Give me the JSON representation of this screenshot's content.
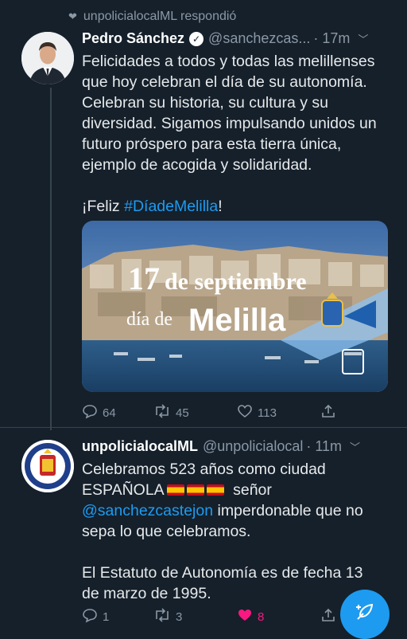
{
  "reply_header": {
    "text": "unpolicialocalML respondió",
    "icon": "heart-icon"
  },
  "tweet1": {
    "name": "Pedro Sánchez",
    "handle": "@sanchezcas...",
    "time": "· 17m",
    "body_lines": [
      "Felicidades a todos y todas las melillenses",
      "que hoy celebran el día de su autonomía.",
      "Celebran su historia, su cultura y su",
      "diversidad. Sigamos impulsando unidos un",
      "futuro próspero para esta tierra única,",
      "ejemplo de acogida y solidaridad."
    ],
    "closing_prefix": "¡Feliz ",
    "hashtag": "#DíadeMelilla",
    "closing_suffix": "!",
    "media": {
      "line1_num": "17",
      "line1_rest": "de septiembre",
      "line2_prefix": "día de",
      "line2_city": "Melilla"
    },
    "actions": {
      "replies": "64",
      "retweets": "45",
      "likes": "113"
    }
  },
  "tweet2": {
    "name": "unpolicialocalML",
    "handle": "@unpolicialocal",
    "time": "· 11m",
    "avatar_text": "POLICÍA LOCAL",
    "avatar_text_bottom": "MELILLA",
    "line1": "Celebramos 523 años como ciudad",
    "line2_text": "ESPAÑOLA",
    "line2_suffix": "señor",
    "mention": "@sanchezcastejon",
    "line3_suffix": " imperdonable que no",
    "line4": "sepa lo que celebramos.",
    "para2_line1": "El Estatuto de Autonomía es de fecha 13",
    "para2_line2": "de marzo de 1995.",
    "actions": {
      "replies": "1",
      "retweets": "3",
      "likes": "8"
    }
  },
  "colors": {
    "background": "#15202b",
    "accent": "#1d9bf0",
    "like": "#f91880",
    "muted": "#8b98a5"
  }
}
